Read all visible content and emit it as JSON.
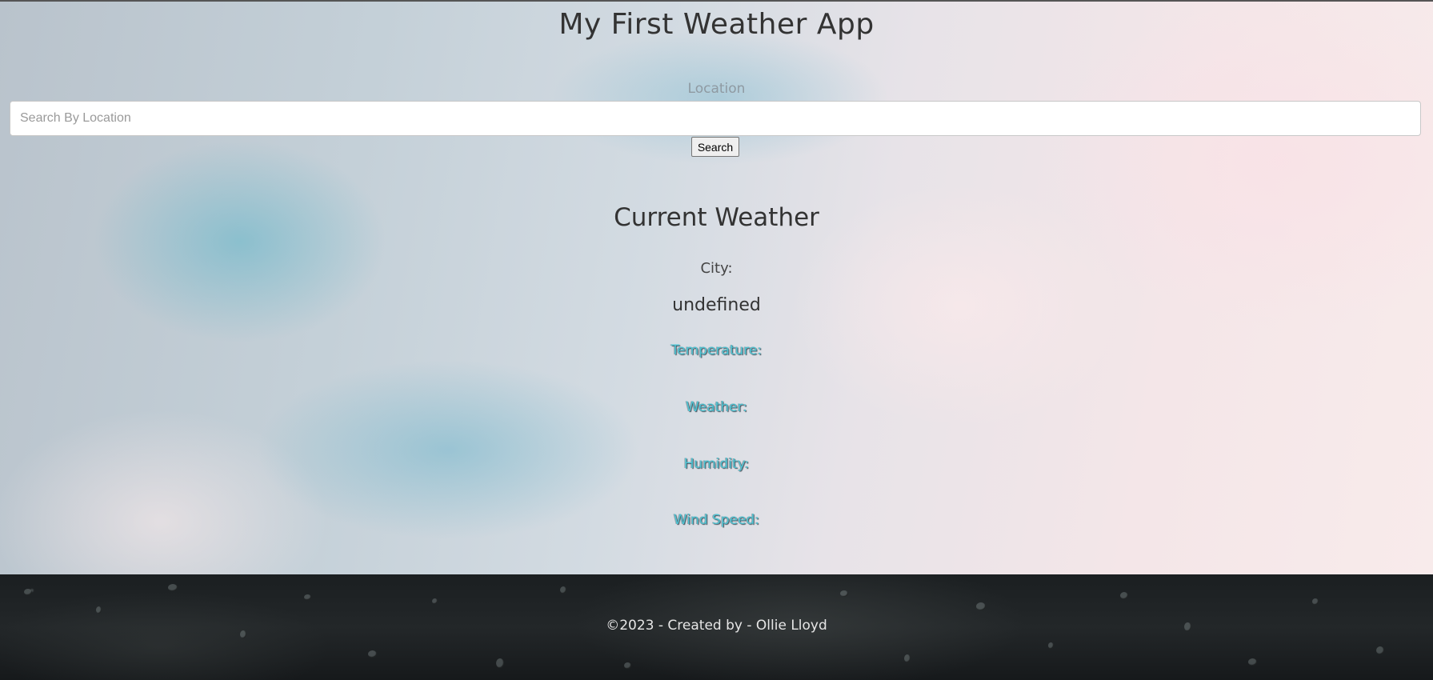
{
  "header": {
    "title": "My First Weather App"
  },
  "search": {
    "label": "Location",
    "placeholder": "Search By Location",
    "value": "",
    "button_label": "Search"
  },
  "current_weather": {
    "title": "Current Weather",
    "city_label": "City:",
    "city_value": "undefined",
    "temperature_label": "Temperature:",
    "weather_label": "Weather:",
    "humidity_label": "Humidity:",
    "wind_speed_label": "Wind Speed:"
  },
  "footer": {
    "text": "©2023 - Created by - Ollie Lloyd"
  },
  "colors": {
    "stat_label": "#4ec3d2",
    "footer_bg": "#1b1f21",
    "text": "#333333"
  }
}
